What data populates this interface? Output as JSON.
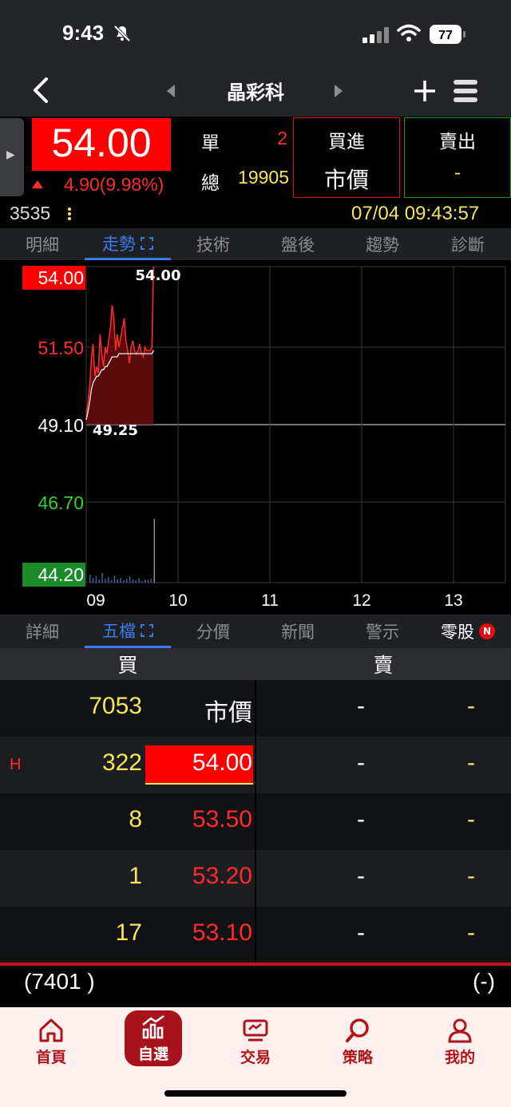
{
  "status_bar": {
    "time": "9:43",
    "battery": "77"
  },
  "nav": {
    "stock_name": "晶彩科"
  },
  "quote": {
    "price": "54.00",
    "change": "4.90(9.98%)",
    "single_label": "單",
    "single_value": "2",
    "total_label": "總",
    "total_value": "19905",
    "buy_label": "買進",
    "buy_value": "市價",
    "sell_label": "賣出",
    "sell_value": "-",
    "code": "3535",
    "datetime": "07/04 09:43:57"
  },
  "tabs_top": [
    "明細",
    "走勢",
    "技術",
    "盤後",
    "趨勢",
    "診斷"
  ],
  "tabs_top_active": 1,
  "chart_data": {
    "type": "line",
    "title": "",
    "y_ticks": [
      "54.00",
      "51.50",
      "49.10",
      "46.70",
      "44.20"
    ],
    "x_ticks": [
      "09",
      "10",
      "11",
      "12",
      "13"
    ],
    "ylim": [
      44.2,
      54.0
    ],
    "reference_price": 49.1,
    "high_label": "54.00",
    "low_label": "49.25",
    "price_series": [
      49.25,
      49.8,
      50.3,
      51.2,
      51.6,
      50.6,
      50.9,
      50.7,
      51.9,
      51.3,
      50.9,
      51.5,
      51.3,
      51.7,
      52.1,
      52.8,
      52.4,
      51.4,
      51.9,
      51.5,
      51.8,
      52.1,
      52.4,
      51.7,
      51.4,
      51.0,
      51.5,
      51.7,
      51.4,
      51.3,
      51.4,
      51.6,
      51.3,
      51.2,
      51.5,
      51.4,
      51.4,
      51.4,
      51.5,
      54.0
    ],
    "avg_series": [
      49.25,
      49.5,
      49.8,
      50.2,
      50.4,
      50.5,
      50.6,
      50.6,
      50.7,
      50.8,
      50.8,
      50.9,
      50.9,
      51.0,
      51.1,
      51.2,
      51.2,
      51.2,
      51.2,
      51.3,
      51.3,
      51.3,
      51.3,
      51.3,
      51.3,
      51.3,
      51.3,
      51.3,
      51.3,
      51.3,
      51.3,
      51.3,
      51.3,
      51.3,
      51.3,
      51.3,
      51.3,
      51.3,
      51.3,
      51.4
    ]
  },
  "tabs_bottom": [
    "詳細",
    "五檔",
    "分價",
    "新聞",
    "警示",
    "零股"
  ],
  "tabs_bottom_active": 1,
  "tabs_bottom_badge": "N",
  "order_book": {
    "buy_header": "買",
    "sell_header": "賣",
    "high_mark": "H",
    "rows": [
      {
        "bid_vol": "7053",
        "bid_price": "市價",
        "ask_price": "-",
        "ask_vol": "-"
      },
      {
        "bid_vol": "322",
        "bid_price": "54.00",
        "ask_price": "-",
        "ask_vol": "-"
      },
      {
        "bid_vol": "8",
        "bid_price": "53.50",
        "ask_price": "-",
        "ask_vol": "-"
      },
      {
        "bid_vol": "1",
        "bid_price": "53.20",
        "ask_price": "-",
        "ask_vol": "-"
      },
      {
        "bid_vol": "17",
        "bid_price": "53.10",
        "ask_price": "-",
        "ask_vol": "-"
      }
    ],
    "bid_total": "(7401 )",
    "ask_total": "(-)"
  },
  "bottom_nav": [
    {
      "label": "首頁",
      "icon": "home-icon"
    },
    {
      "label": "自選",
      "icon": "chart-icon"
    },
    {
      "label": "交易",
      "icon": "trade-icon"
    },
    {
      "label": "策略",
      "icon": "search-icon"
    },
    {
      "label": "我的",
      "icon": "user-icon"
    }
  ],
  "colors": {
    "up": "#ff2a2a",
    "down": "#2fd62f",
    "accent": "#3a7cf0",
    "brand": "#a8121b",
    "volume": "#f7e65a"
  }
}
